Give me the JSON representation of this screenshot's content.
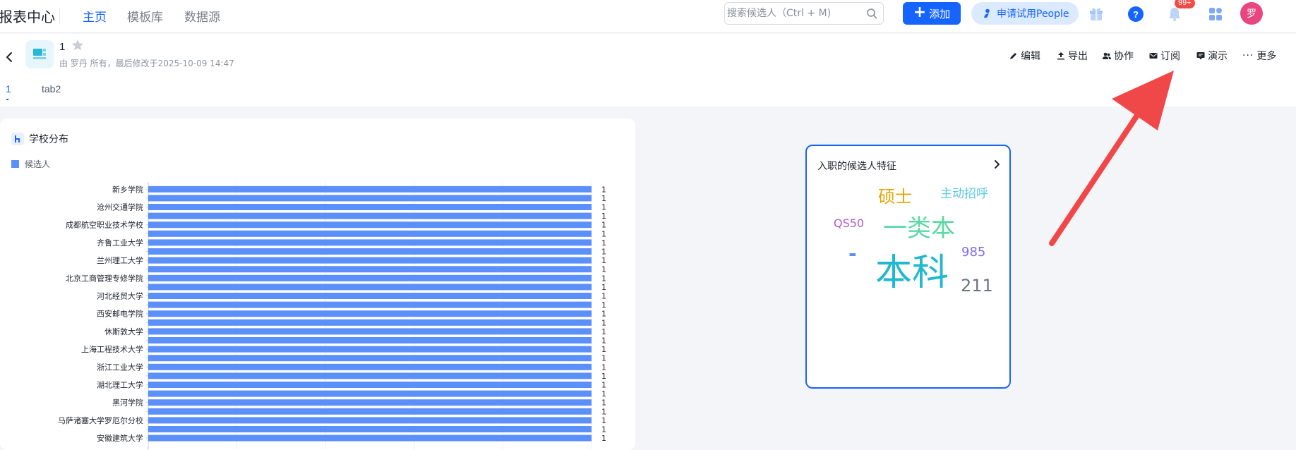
{
  "app": {
    "title": "报表中心"
  },
  "nav": {
    "home": "主页",
    "templates": "模板库",
    "datasource": "数据源"
  },
  "search": {
    "placeholder": "搜索候选人（Ctrl + M)"
  },
  "toolbar": {
    "add_label": "添加",
    "trial_label": "申请试用People",
    "notification_count": "99+",
    "avatar_initial": "罗"
  },
  "report": {
    "name": "1",
    "meta": "由 罗丹 所有，最后修改于2025-10-09 14:47"
  },
  "actions": {
    "edit": "编辑",
    "export": "导出",
    "collab": "协作",
    "subscribe": "订阅",
    "present": "演示",
    "more": "更多"
  },
  "tabs": [
    {
      "label": "1"
    },
    {
      "label": "tab2"
    }
  ],
  "chart_card": {
    "title": "学校分布"
  },
  "chart_data": {
    "type": "bar",
    "orientation": "horizontal",
    "title": "学校分布",
    "series": [
      {
        "name": "候选人",
        "color": "#5b8ff9"
      }
    ],
    "categories": [
      "新乡学院",
      "",
      "沧州交通学院",
      "",
      "成都航空职业技术学校",
      "",
      "齐鲁工业大学",
      "",
      "兰州理工大学",
      "",
      "北京工商管理专修学院",
      "",
      "河北经贸大学",
      "",
      "西安邮电学院",
      "",
      "休斯敦大学",
      "",
      "上海工程技术大学",
      "",
      "浙江工业大学",
      "",
      "湖北理工大学",
      "",
      "黑河学院",
      "",
      "马萨诸塞大学罗厄尔分校",
      "",
      "安徽建筑大学"
    ],
    "values": [
      1,
      1,
      1,
      1,
      1,
      1,
      1,
      1,
      1,
      1,
      1,
      1,
      1,
      1,
      1,
      1,
      1,
      1,
      1,
      1,
      1,
      1,
      1,
      1,
      1,
      1,
      1,
      1,
      1
    ],
    "data_labels_visible": true,
    "xlim": [
      0,
      1
    ],
    "grid": true,
    "legend_position": "top-left"
  },
  "wordcloud": {
    "title": "入职的候选人特征",
    "words": [
      {
        "text": "硕士",
        "color": "#e8a400"
      },
      {
        "text": "主动招呼",
        "color": "#5ac8e8"
      },
      {
        "text": "QS50",
        "color": "#b059c8"
      },
      {
        "text": "一类本",
        "color": "#5ad8a6"
      },
      {
        "text": "-",
        "color": "#5b8ff9"
      },
      {
        "text": "本科",
        "color": "#20b8d0"
      },
      {
        "text": "985",
        "color": "#7c6df0"
      },
      {
        "text": "211",
        "color": "#6b7582"
      }
    ]
  }
}
